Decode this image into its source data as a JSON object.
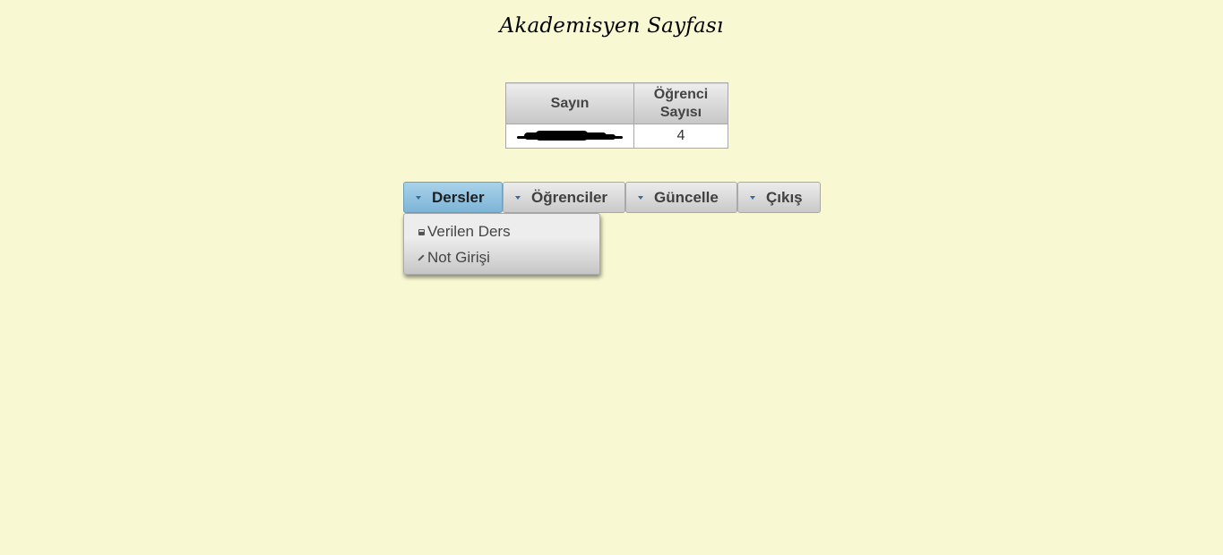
{
  "page": {
    "title": "Akademisyen Sayfası"
  },
  "info_table": {
    "headers": [
      "Sayın",
      "Öğrenci Sayısı"
    ],
    "header_lines": {
      "col2_line1": "Öğrenci",
      "col2_line2": "Sayısı"
    },
    "rows": [
      {
        "name": "",
        "student_count": "4"
      }
    ]
  },
  "menu": {
    "items": [
      {
        "label": "Dersler",
        "active": true
      },
      {
        "label": "Öğrenciler",
        "active": false
      },
      {
        "label": "Güncelle",
        "active": false
      },
      {
        "label": "Çıkış",
        "active": false
      }
    ],
    "dropdown": [
      {
        "label": "Verilen Ders",
        "icon": "save-icon"
      },
      {
        "label": "Not Girişi",
        "icon": "pencil-icon"
      }
    ]
  },
  "colors": {
    "background": "#f8f8d2",
    "active_tab": "#8fc2e0"
  }
}
